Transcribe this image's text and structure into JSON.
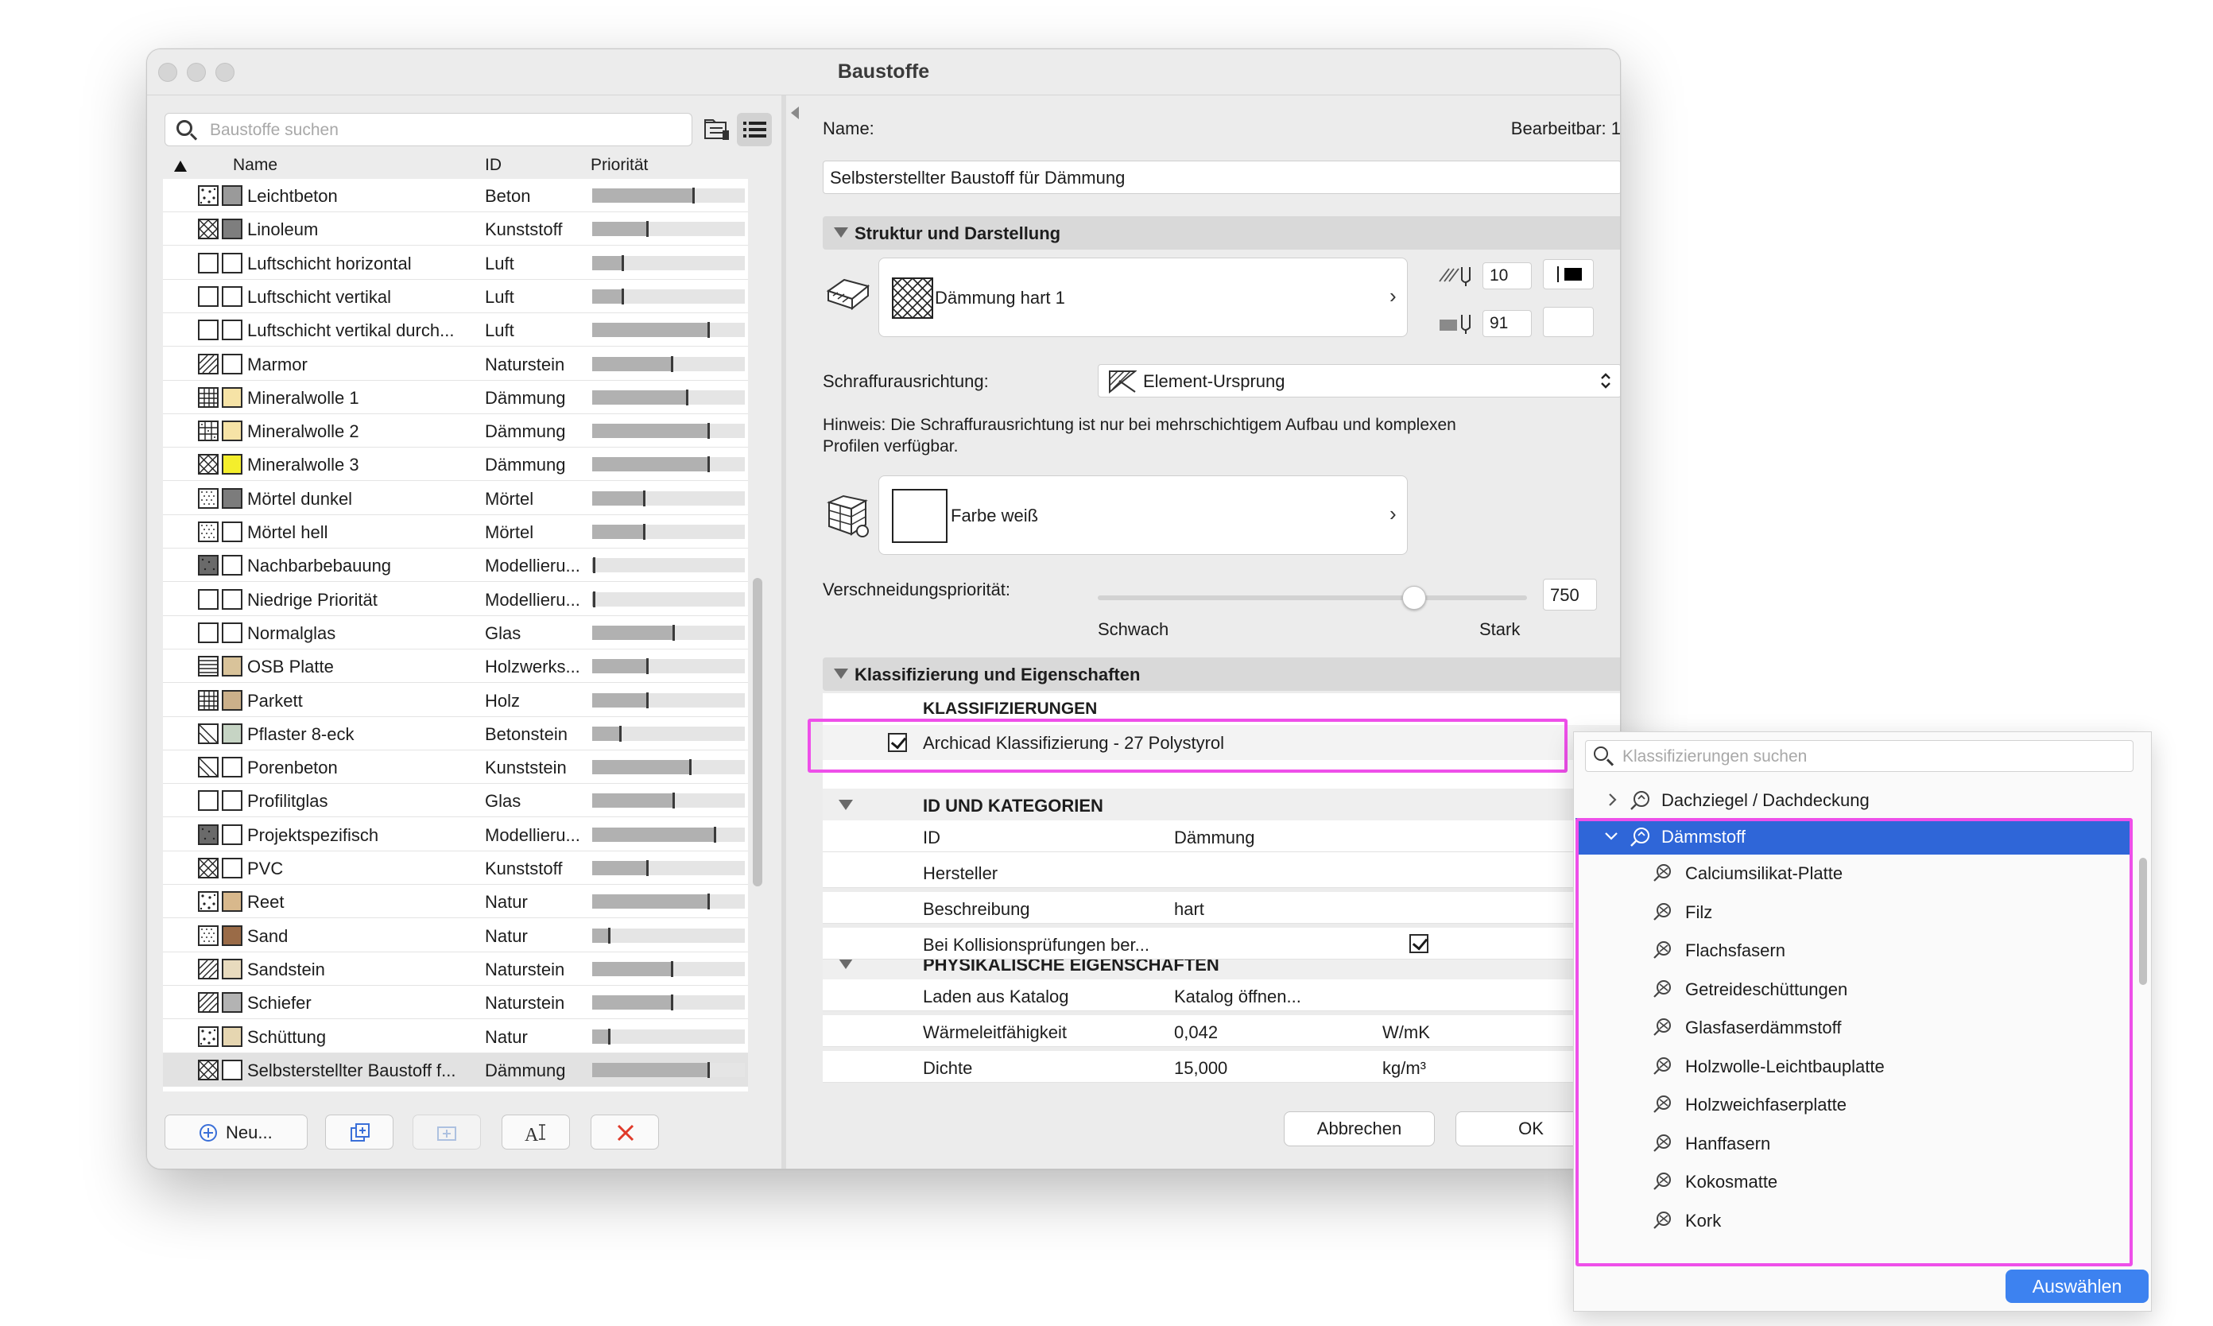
{
  "window": {
    "title": "Baustoffe"
  },
  "left": {
    "search_placeholder": "Baustoffe suchen",
    "columns": {
      "name": "Name",
      "id": "ID",
      "priority": "Priorität"
    },
    "rows": [
      {
        "name": "Leichtbeton",
        "id": "Beton",
        "priority": 0.66,
        "swatch": "#9a9a9a",
        "pattern": "dots"
      },
      {
        "name": "Linoleum",
        "id": "Kunststoff",
        "priority": 0.36,
        "swatch": "#7e7e7e",
        "pattern": "cross"
      },
      {
        "name": "Luftschicht horizontal",
        "id": "Luft",
        "priority": 0.2,
        "swatch": "#ffffff",
        "pattern": "none"
      },
      {
        "name": "Luftschicht vertikal",
        "id": "Luft",
        "priority": 0.2,
        "swatch": "#ffffff",
        "pattern": "none"
      },
      {
        "name": "Luftschicht vertikal durch...",
        "id": "Luft",
        "priority": 0.76,
        "swatch": "#ffffff",
        "pattern": "none"
      },
      {
        "name": "Marmor",
        "id": "Naturstein",
        "priority": 0.52,
        "swatch": "#ffffff",
        "pattern": "hatch"
      },
      {
        "name": "Mineralwolle 1",
        "id": "Dämmung",
        "priority": 0.62,
        "swatch": "#f6e3a6",
        "pattern": "grid"
      },
      {
        "name": "Mineralwolle 2",
        "id": "Dämmung",
        "priority": 0.76,
        "swatch": "#f6e3a6",
        "pattern": "grid2"
      },
      {
        "name": "Mineralwolle 3",
        "id": "Dämmung",
        "priority": 0.76,
        "swatch": "#f4ee2c",
        "pattern": "cross"
      },
      {
        "name": "Mörtel dunkel",
        "id": "Mörtel",
        "priority": 0.34,
        "swatch": "#7c7c7c",
        "pattern": "dots2"
      },
      {
        "name": "Mörtel hell",
        "id": "Mörtel",
        "priority": 0.34,
        "swatch": "#ffffff",
        "pattern": "dots2"
      },
      {
        "name": "Nachbarbebauung",
        "id": "Modellieru...",
        "priority": 0.01,
        "swatch": "#ffffff",
        "pattern": "dark"
      },
      {
        "name": "Niedrige Priorität",
        "id": "Modellieru...",
        "priority": 0.01,
        "swatch": "#ffffff",
        "pattern": "none"
      },
      {
        "name": "Normalglas",
        "id": "Glas",
        "priority": 0.53,
        "swatch": "#ffffff",
        "pattern": "none"
      },
      {
        "name": "OSB Platte",
        "id": "Holzwerks...",
        "priority": 0.36,
        "swatch": "#d9c39a",
        "pattern": "lines"
      },
      {
        "name": "Parkett",
        "id": "Holz",
        "priority": 0.36,
        "swatch": "#cbb08a",
        "pattern": "grid"
      },
      {
        "name": "Pflaster 8-eck",
        "id": "Betonstein",
        "priority": 0.18,
        "swatch": "#c6d4c4",
        "pattern": "diag"
      },
      {
        "name": "Porenbeton",
        "id": "Kunststein",
        "priority": 0.64,
        "swatch": "#ffffff",
        "pattern": "diag"
      },
      {
        "name": "Profilitglas",
        "id": "Glas",
        "priority": 0.53,
        "swatch": "#ffffff",
        "pattern": "none"
      },
      {
        "name": "Projektspezifisch",
        "id": "Modellieru...",
        "priority": 0.8,
        "swatch": "#ffffff",
        "pattern": "dark"
      },
      {
        "name": "PVC",
        "id": "Kunststoff",
        "priority": 0.36,
        "swatch": "#ffffff",
        "pattern": "cross"
      },
      {
        "name": "Reet",
        "id": "Natur",
        "priority": 0.76,
        "swatch": "#d8b88c",
        "pattern": "dots"
      },
      {
        "name": "Sand",
        "id": "Natur",
        "priority": 0.11,
        "swatch": "#9a6b47",
        "pattern": "dots2"
      },
      {
        "name": "Sandstein",
        "id": "Naturstein",
        "priority": 0.52,
        "swatch": "#e8dbbe",
        "pattern": "hatch"
      },
      {
        "name": "Schiefer",
        "id": "Naturstein",
        "priority": 0.52,
        "swatch": "#b3b3b3",
        "pattern": "hatch"
      },
      {
        "name": "Schüttung",
        "id": "Natur",
        "priority": 0.11,
        "swatch": "#e6d6b1",
        "pattern": "dots"
      },
      {
        "name": "Selbsterstellter Baustoff f...",
        "id": "Dämmung",
        "priority": 0.76,
        "swatch": "#ffffff",
        "pattern": "cross"
      }
    ],
    "buttons": {
      "new": "Neu..."
    }
  },
  "right": {
    "name_label": "Name:",
    "editable": "Bearbeitbar: 1",
    "name_value": "Selbsterstellter Baustoff für Dämmung",
    "section_structure": "Struktur und Darstellung",
    "fill_name": "Dämmung hart 1",
    "pen_value_1": "10",
    "pen_value_2": "91",
    "hatch_orientation_label": "Schraffurausrichtung:",
    "hatch_orientation_value": "Element-Ursprung",
    "hint_line1": "Hinweis: Die Schraffurausrichtung ist nur bei mehrschichtigem Aufbau und komplexen",
    "hint_line2": "Profilen verfügbar.",
    "surface_name": "Farbe weiß",
    "intersection_label": "Verschneidungspriorität:",
    "intersection_value": "750",
    "intersection_fraction": 0.75,
    "slider_min": "Schwach",
    "slider_max": "Stark",
    "section_classification": "Klassifizierung und Eigenschaften",
    "classifications_header": "KLASSIFIZIERUNGEN",
    "classification_item": "Archicad Klassifizierung - 27 Polystyrol",
    "group_id": "ID UND KATEGORIEN",
    "props_id": [
      {
        "key": "ID",
        "value": "Dämmung"
      },
      {
        "key": "Hersteller",
        "value": ""
      },
      {
        "key": "Beschreibung",
        "value": "hart"
      },
      {
        "key": "Bei Kollisionsprüfungen ber...",
        "value": ""
      }
    ],
    "group_physical": "PHYSIKALISCHE EIGENSCHAFTEN",
    "props_physical": [
      {
        "key": "Laden aus Katalog",
        "value": "Katalog öffnen...",
        "unit": ""
      },
      {
        "key": "Wärmeleitfähigkeit",
        "value": "0,042",
        "unit": "W/mK"
      },
      {
        "key": "Dichte",
        "value": "15,000",
        "unit": "kg/m³"
      }
    ],
    "cancel": "Abbrechen",
    "ok": "OK"
  },
  "popup": {
    "search_placeholder": "Klassifizierungen suchen",
    "parent_collapsed": "Dachziegel / Dachdeckung",
    "parent_expanded": "Dämmstoff",
    "children": [
      "Calciumsilikat-Platte",
      "Filz",
      "Flachsfasern",
      "Getreideschüttungen",
      "Glasfaserdämmstoff",
      "Holzwolle-Leichtbauplatte",
      "Holzweichfaserplatte",
      "Hanffasern",
      "Kokosmatte",
      "Kork"
    ],
    "select_button": "Auswählen"
  },
  "colors": {
    "highlight": "#ee4fe9",
    "selection": "#2f66d8",
    "primary_button": "#3d82f0"
  }
}
